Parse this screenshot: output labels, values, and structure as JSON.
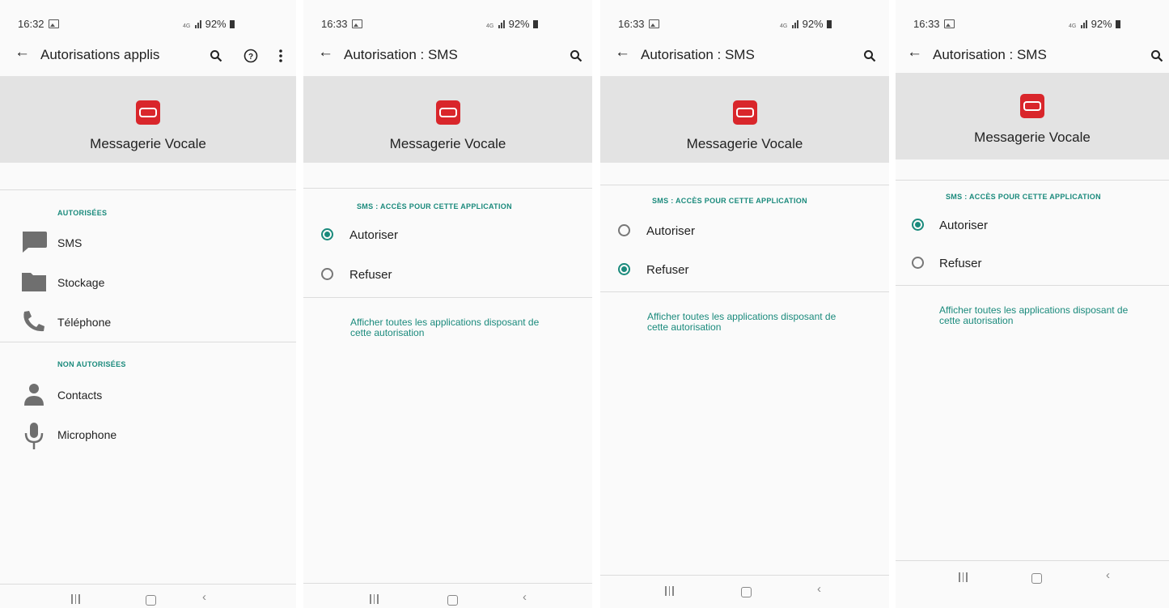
{
  "colors": {
    "accent": "#1a8a7c",
    "header_band": "#e3e3e3",
    "app_icon": "#d9262b",
    "background": "#fafafa"
  },
  "screens": [
    {
      "status": {
        "time": "16:32",
        "network": "4G",
        "battery": "92%"
      },
      "appbar": {
        "title": "Autorisations applis",
        "actions": [
          "search-icon",
          "help-icon",
          "more-vert-icon"
        ]
      },
      "app": {
        "name": "Messagerie Vocale"
      },
      "allowed_header": "AUTORISÉES",
      "allowed": [
        {
          "icon": "message-icon",
          "label": "SMS"
        },
        {
          "icon": "folder-icon",
          "label": "Stockage"
        },
        {
          "icon": "phone-icon",
          "label": "Téléphone"
        }
      ],
      "denied_header": "NON AUTORISÉES",
      "denied": [
        {
          "icon": "person-icon",
          "label": "Contacts"
        },
        {
          "icon": "microphone-icon",
          "label": "Microphone"
        }
      ]
    },
    {
      "status": {
        "time": "16:33",
        "network": "4G",
        "battery": "92%"
      },
      "appbar": {
        "title": "Autorisation : SMS"
      },
      "app": {
        "name": "Messagerie Vocale"
      },
      "section_header": "SMS : ACCÈS POUR CETTE APPLICATION",
      "options": [
        {
          "label": "Autoriser",
          "selected": true
        },
        {
          "label": "Refuser",
          "selected": false
        }
      ],
      "link": "Afficher toutes les applications disposant de cette autorisation"
    },
    {
      "status": {
        "time": "16:33",
        "network": "4G",
        "battery": "92%"
      },
      "appbar": {
        "title": "Autorisation : SMS"
      },
      "app": {
        "name": "Messagerie Vocale"
      },
      "section_header": "SMS : ACCÈS POUR CETTE APPLICATION",
      "options": [
        {
          "label": "Autoriser",
          "selected": false
        },
        {
          "label": "Refuser",
          "selected": true
        }
      ],
      "link": "Afficher toutes les applications disposant de cette autorisation"
    },
    {
      "status": {
        "time": "16:33",
        "network": "4G",
        "battery": "92%"
      },
      "appbar": {
        "title": "Autorisation : SMS"
      },
      "app": {
        "name": "Messagerie Vocale"
      },
      "section_header": "SMS : ACCÈS POUR CETTE APPLICATION",
      "options": [
        {
          "label": "Autoriser",
          "selected": true
        },
        {
          "label": "Refuser",
          "selected": false
        }
      ],
      "link": "Afficher toutes les applications disposant de cette autorisation"
    }
  ]
}
